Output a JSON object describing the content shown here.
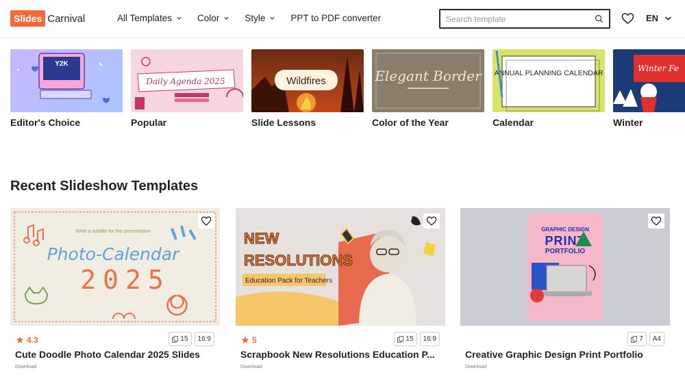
{
  "header": {
    "logo_box": "Slides",
    "logo_text": "Carnival",
    "nav": [
      {
        "label": "All Templates",
        "has_chevron": true
      },
      {
        "label": "Color",
        "has_chevron": true
      },
      {
        "label": "Style",
        "has_chevron": true
      },
      {
        "label": "PPT to PDF converter",
        "has_chevron": false
      }
    ],
    "search_placeholder": "Search template",
    "language": "EN"
  },
  "categories": [
    {
      "label": "Editor's Choice",
      "thumb_text": "Y2K"
    },
    {
      "label": "Popular",
      "thumb_text": "Daily Agenda 2025"
    },
    {
      "label": "Slide Lessons",
      "thumb_text": "Wildfires"
    },
    {
      "label": "Color of the Year",
      "thumb_text": "Elegant Border"
    },
    {
      "label": "Calendar",
      "thumb_text": "ANNUAL PLANNING CALENDAR"
    },
    {
      "label": "Winter",
      "thumb_text": "Winter Fe"
    }
  ],
  "section_title": "Recent Slideshow Templates",
  "cards": [
    {
      "title": "Cute Doodle Photo Calendar 2025 Slides",
      "rating": "4.3",
      "slides": "15",
      "ratio": "16:9",
      "sub": "Download",
      "thumb_line1": "Photo-Calendar",
      "thumb_line2": "2025",
      "thumb_small": "Write a subtitle for this presentation"
    },
    {
      "title": "Scrapbook New Resolutions Education P...",
      "rating": "5",
      "slides": "15",
      "ratio": "16:9",
      "sub": "Download",
      "thumb_line1": "NEW",
      "thumb_line2": "RESOLUTIONS",
      "thumb_small": "Education Pack for Teachers"
    },
    {
      "title": "Creative Graphic Design Print Portfolio",
      "rating": "",
      "slides": "7",
      "ratio": "A4",
      "sub": "Download",
      "thumb_line1": "GRAPHIC DESIGN",
      "thumb_line2": "PRINT",
      "thumb_small": "PORTFOLIO"
    }
  ],
  "colors": {
    "brand": "#f26a3a",
    "rating": "#e8713e",
    "search_border": "#1f2a3a"
  }
}
